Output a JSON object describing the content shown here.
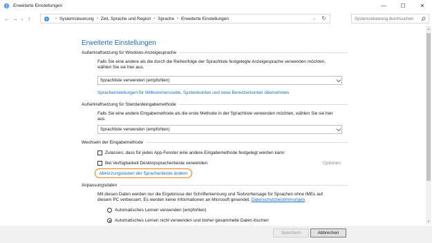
{
  "window": {
    "title": "Erweiterte Einstellungen",
    "controls": {
      "minimize": "—",
      "maximize": "☐",
      "close": "✕"
    }
  },
  "nav": {
    "back": "←",
    "forward": "→",
    "recent": "⌄",
    "up": "↑",
    "breadcrumb_sep": "›",
    "breadcrumbs": [
      "Systemsteuerung",
      "Zeit, Sprache und Region",
      "Sprache",
      "Erweiterte Einstellungen"
    ],
    "address_dropdown": "⌄",
    "refresh": "↻",
    "search_placeholder": "Systemsteuerung durchsuchen"
  },
  "page": {
    "title": "Erweiterte Einstellungen",
    "sections": {
      "display_lang": {
        "heading": "Außerkraftsetzung für Windows-Anzeigesprache",
        "desc_lines": [
          "Falls Sie eine andere als die durch die Reihenfolge der Sprachliste festgelegte Anzeigesprache verwenden möchten,",
          "wählen Sie sie hier aus."
        ],
        "combo_value": "Sprachliste verwenden (empfohlen)",
        "link": "Spracheinstellungen für Willkommensseite, Systemkonten und neue Benutzerkonten übernehmen"
      },
      "input_method": {
        "heading": "Außerkraftsetzung für Standardeingabemethode",
        "desc_lines": [
          "Falls Sie eine andere Eingabemethode als die erste Methode in der Sprachliste verwenden möchten, wählen Sie sie hier",
          "aus."
        ],
        "combo_value": "Sprachliste verwenden (empfohlen)"
      },
      "switching": {
        "heading": "Wechseln der Eingabemethode",
        "checkbox1": "Zulassen, dass für jedes App-Fenster eine andere Eingabemethode festgelegt werden kann",
        "checkbox2": "Bei Verfügbarkeit Desktopsprachenleiste verwenden",
        "options": "Optionen",
        "hotkeys_link": "Abkürzungstasten der Sprachenleiste ändern"
      },
      "adaptation": {
        "heading": "Anpassungsdaten",
        "desc_line1": "Mit diesen Daten werden nur die Ergebnisse der Schrifterkennung und Textvorhersage für Sprachen ohne IMEs auf",
        "desc_line2": "diesem PC verbessert. Es werden keine Informationen an Microsoft gesendet.",
        "privacy_link": "Datenschutzbestimmungen",
        "radio1": "Automatisches Lernen verwenden (empfohlen)",
        "radio2": "Automatisches Lernen nicht verwenden und bisher gesammelte Daten löschen"
      }
    }
  },
  "footer": {
    "save": "Speichern",
    "cancel": "Abbrechen"
  },
  "colors": {
    "accent": "#1e6db5",
    "link": "#1a6fc4",
    "highlight": "#f07a1a"
  }
}
